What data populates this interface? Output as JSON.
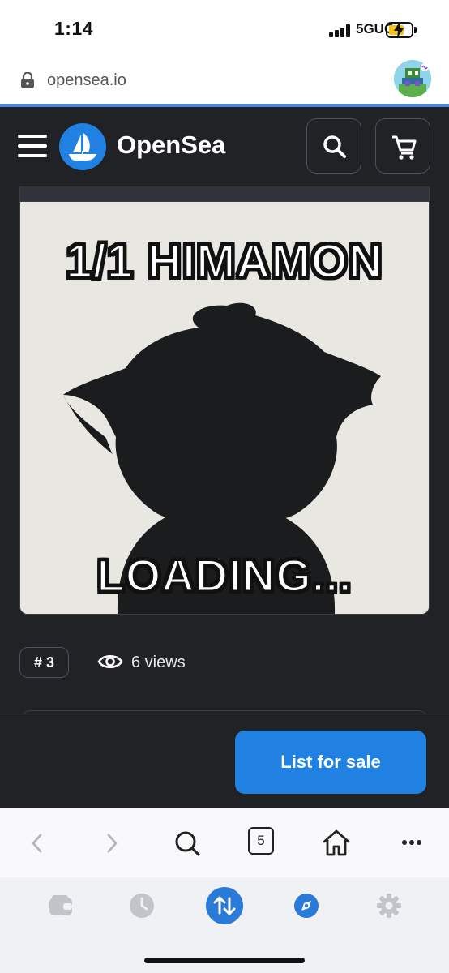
{
  "status": {
    "time": "1:14",
    "network": "5GUC"
  },
  "browser": {
    "url": "opensea.io",
    "tab_count": "5"
  },
  "header": {
    "brand": "OpenSea"
  },
  "nft": {
    "title": "1/1 HIMAMON",
    "overlay_text": "LOADING...",
    "token_badge": "# 3",
    "views": "6 views"
  },
  "actions": {
    "list_for_sale": "List for sale"
  },
  "colors": {
    "accent": "#2081e2",
    "header_bg": "#202225",
    "artwork_bg": "#e9e7e2",
    "silhouette": "#1b1c1e"
  },
  "icons": {
    "status": [
      "signal-icon",
      "battery-icon"
    ],
    "url_bar": [
      "lock-icon",
      "avatar"
    ],
    "header": [
      "menu-icon",
      "opensea-logo-icon",
      "search-icon",
      "cart-icon"
    ],
    "toolbar": [
      "back-icon",
      "forward-icon",
      "search-icon",
      "tabs-icon",
      "home-icon",
      "more-icon"
    ],
    "dock": [
      "wallet-icon",
      "history-icon",
      "swap-icon",
      "explore-icon",
      "settings-icon"
    ]
  }
}
